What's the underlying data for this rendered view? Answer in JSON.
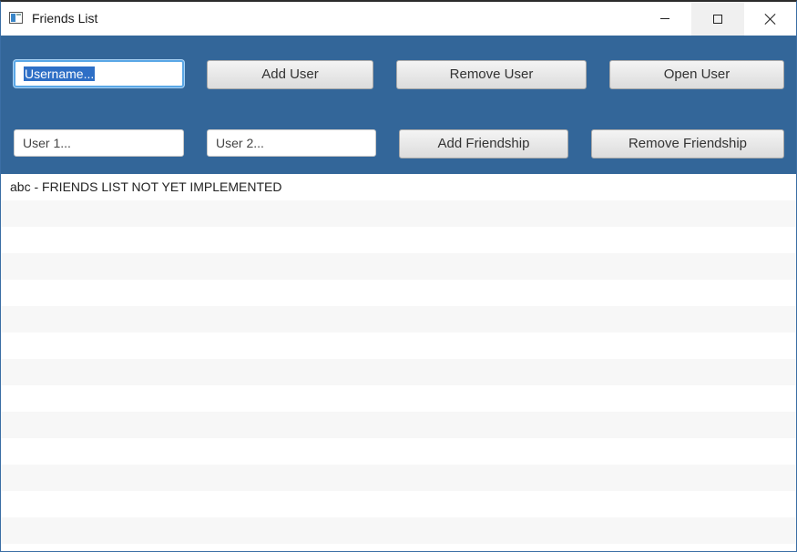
{
  "window": {
    "title": "Friends List",
    "controls": [
      "minimize-icon",
      "maximize-icon",
      "close-icon"
    ]
  },
  "toolbar": {
    "username": {
      "placeholder": "Username...",
      "value": "Username..."
    },
    "add_user": "Add User",
    "remove_user": "Remove User",
    "open_user": "Open User",
    "user1": {
      "placeholder": "User 1..."
    },
    "user2": {
      "placeholder": "User 2..."
    },
    "add_friendship": "Add Friendship",
    "remove_friendship": "Remove Friendship"
  },
  "colors": {
    "toolbar_bg": "#336699",
    "focus_ring": "#5aa7e6",
    "selection": "#2e6fc6"
  },
  "list": {
    "items": [
      "abc -  FRIENDS LIST NOT YET IMPLEMENTED",
      "",
      "",
      "",
      "",
      "",
      "",
      "",
      "",
      "",
      "",
      "",
      "",
      ""
    ]
  }
}
